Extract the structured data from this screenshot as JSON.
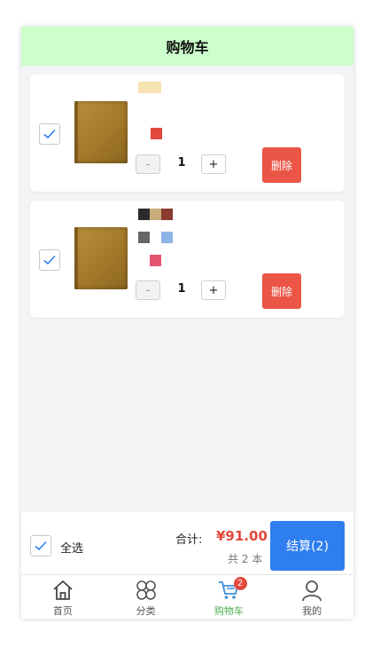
{
  "header": {
    "title": "购物车"
  },
  "cart_items": [
    {
      "checked": true,
      "quantity": "1",
      "minus_label": "-",
      "plus_label": "+",
      "delete_label": "删除"
    },
    {
      "checked": true,
      "quantity": "1",
      "minus_label": "-",
      "plus_label": "+",
      "delete_label": "删除"
    }
  ],
  "footer": {
    "select_all_label": "全选",
    "total_label": "合计:",
    "total_value": "¥91.00",
    "count_text": "共 2 本",
    "checkout_label": "结算(2)"
  },
  "tabbar": {
    "items": [
      {
        "label": "首页",
        "icon": "home-icon"
      },
      {
        "label": "分类",
        "icon": "category-icon"
      },
      {
        "label": "购物车",
        "icon": "cart-icon",
        "badge": "2",
        "active": true
      },
      {
        "label": "我的",
        "icon": "user-icon"
      }
    ]
  },
  "colors": {
    "header_bg": "#ccffcc",
    "accent_blue": "#2f7ef0",
    "delete_red": "#ea5545",
    "price_red": "#e2483b",
    "active_tab_green": "#4caf50"
  }
}
